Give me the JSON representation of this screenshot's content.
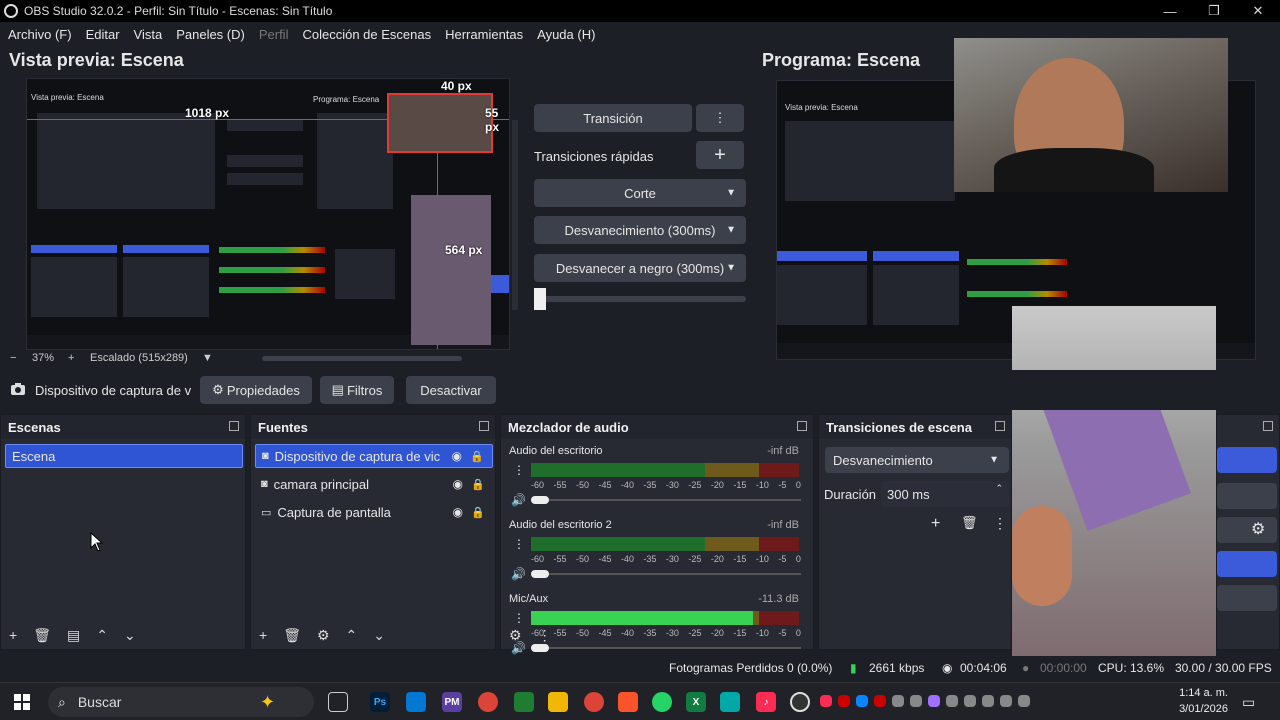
{
  "window": {
    "title": "OBS Studio 32.0.2 - Perfil: Sin Título - Escenas: Sin Título",
    "minimize": "—",
    "maximize": "❐",
    "close": "✕"
  },
  "menu": {
    "items": [
      "Archivo (F)",
      "Editar",
      "Vista",
      "Paneles (D)",
      "Perfil",
      "Colección de Escenas",
      "Herramientas",
      "Ayuda (H)"
    ]
  },
  "preview": {
    "title": "Vista previa: Escena",
    "measure_top": "40 px",
    "measure_left": "1018 px",
    "measure_right": "55 px",
    "measure_bottom": "564 px",
    "zoom": "37%",
    "scaling": "Escalado (515x289)",
    "inner_title_left": "Vista previa: Escena",
    "inner_title_right": "Programa: Escena"
  },
  "program": {
    "title": "Programa: Escena",
    "inner_title": "Vista previa: Escena"
  },
  "transition": {
    "button": "Transición",
    "quick_label": "Transiciones rápidas",
    "add": "+",
    "options": [
      "Corte",
      "Desvanecimiento (300ms)",
      "Desvanecer a negro (300ms)"
    ]
  },
  "source_toolbar": {
    "source_name": "Dispositivo de captura de v",
    "properties": "Propiedades",
    "filters": "Filtros",
    "deactivate": "Desactivar"
  },
  "scenes": {
    "title": "Escenas",
    "items": [
      "Escena"
    ]
  },
  "sources": {
    "title": "Fuentes",
    "items": [
      "Dispositivo de captura de vic",
      "camara principal",
      "Captura de pantalla"
    ]
  },
  "mixer": {
    "title": "Mezclador de audio",
    "scale": [
      "-60",
      "-55",
      "-50",
      "-45",
      "-40",
      "-35",
      "-30",
      "-25",
      "-20",
      "-15",
      "-10",
      "-5",
      "0"
    ],
    "channels": [
      {
        "name": "Audio del escritorio",
        "db": "-inf dB",
        "level": 0
      },
      {
        "name": "Audio del escritorio 2",
        "db": "-inf dB",
        "level": 0
      },
      {
        "name": "Mic/Aux",
        "db": "-11.3 dB",
        "level": 0.83
      }
    ]
  },
  "scene_transitions": {
    "title": "Transiciones de escena",
    "selected": "Desvanecimiento",
    "duration_label": "Duración",
    "duration_value": "300 ms"
  },
  "status": {
    "dropped": "Fotogramas Perdidos 0 (0.0%)",
    "kbps": "2661 kbps",
    "rec_time": "00:04:06",
    "stream_time": "00:00:00",
    "cpu": "CPU: 13.6%",
    "fps": "30.00 / 30.00 FPS"
  },
  "taskbar": {
    "search": "Buscar",
    "time": "1:14 a. m.",
    "date": "3/01/2026"
  },
  "colors": {
    "accent": "#2f55d4",
    "panel": "#272a33",
    "bg": "#1d1f26"
  }
}
